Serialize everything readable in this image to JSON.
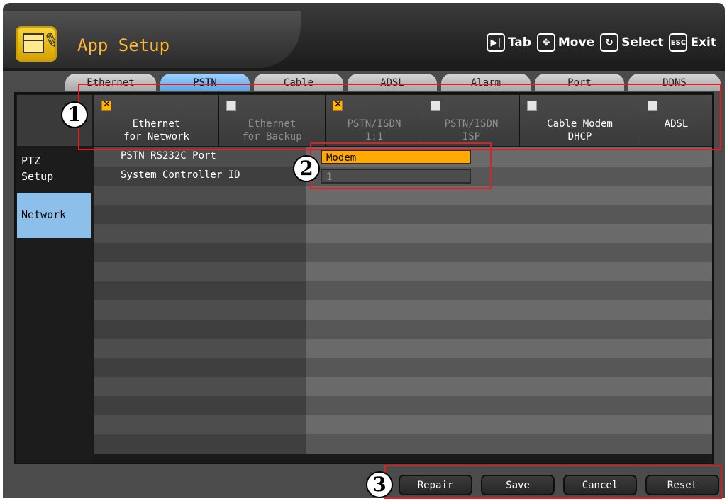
{
  "window": {
    "title": "App Setup",
    "hints": [
      {
        "key": "▶|",
        "label": "Tab"
      },
      {
        "key": "✥",
        "label": "Move"
      },
      {
        "key": "↻",
        "label": "Select"
      },
      {
        "key": "ESC",
        "label": "Exit"
      }
    ]
  },
  "tabs": [
    {
      "label": "Ethernet",
      "active": false
    },
    {
      "label": "PSTN",
      "active": true
    },
    {
      "label": "Cable",
      "active": false
    },
    {
      "label": "ADSL",
      "active": false
    },
    {
      "label": "Alarm",
      "active": false
    },
    {
      "label": "Port",
      "active": false
    },
    {
      "label": "DDNS",
      "active": false
    }
  ],
  "options": [
    {
      "line1": "Ethernet",
      "line2": "for Network",
      "checked": true,
      "enabled": true
    },
    {
      "line1": "Ethernet",
      "line2": "for Backup",
      "checked": false,
      "enabled": false
    },
    {
      "line1": "PSTN/ISDN",
      "line2": "1:1",
      "checked": true,
      "enabled": false
    },
    {
      "line1": "PSTN/ISDN",
      "line2": "ISP",
      "checked": false,
      "enabled": false
    },
    {
      "line1": "Cable Modem",
      "line2": "DHCP",
      "checked": false,
      "enabled": true
    },
    {
      "line1": "ADSL",
      "line2": "",
      "checked": false,
      "enabled": true
    }
  ],
  "sidebar": {
    "items": [
      {
        "line1": "PTZ",
        "line2": "Setup",
        "active": false
      },
      {
        "line1": "Network",
        "line2": "",
        "active": true
      }
    ]
  },
  "settings": {
    "rows": [
      {
        "label": "PSTN RS232C Port",
        "value": "Modem"
      },
      {
        "label": "System Controller ID",
        "value": "1"
      }
    ]
  },
  "buttons": {
    "repair": "Repair",
    "save": "Save",
    "cancel": "Cancel",
    "reset": "Reset"
  },
  "callouts": [
    "1",
    "2",
    "3"
  ],
  "colors": {
    "accent": "#ffaa00",
    "active_tab": "#7bbcf3",
    "annotation": "#e02020"
  }
}
